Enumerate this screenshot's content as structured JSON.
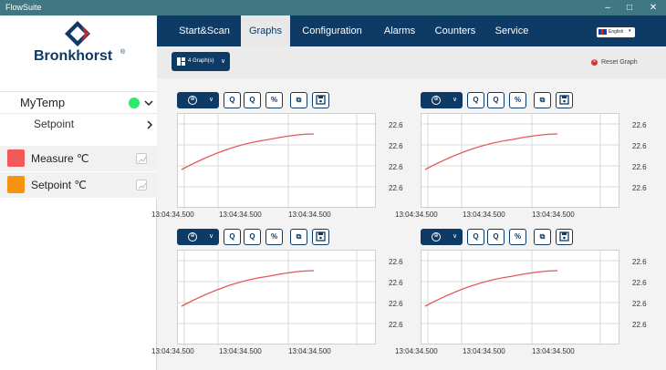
{
  "window": {
    "title": "FlowSuite",
    "controls": [
      "–",
      "□",
      "✕"
    ]
  },
  "brand": {
    "name": "Bronkhorst",
    "registered": "®"
  },
  "device": {
    "name": "MyTemp",
    "status_color": "#2ee86a",
    "parameter": "Setpoint"
  },
  "signals": [
    {
      "label": "Measure",
      "unit": "℃",
      "color": "#f25a5a"
    },
    {
      "label": "Setpoint",
      "unit": "℃",
      "color": "#f7940f"
    }
  ],
  "nav": {
    "tabs": [
      "Start&Scan",
      "Graphs",
      "Configuration",
      "Alarms",
      "Counters",
      "Service"
    ],
    "active": "Graphs",
    "language": "English"
  },
  "toolbar": {
    "graphs_button": "4 Graph(s)",
    "reset": "Reset Graph"
  },
  "graph_tools": {
    "zoom": "⊕",
    "zoom_caret": "∨",
    "zoom_in": "Q",
    "zoom_fit": "Q",
    "percent": "%",
    "crop": "⧉",
    "save": "💾"
  },
  "charts": [
    {
      "y_ticks": [
        "22.6",
        "22.6",
        "22.6",
        "22.6"
      ],
      "x_ticks": [
        "13:04:34.500",
        "13:04:34.500",
        "13:04:34.500"
      ]
    },
    {
      "y_ticks": [
        "22.6",
        "22.6",
        "22.6",
        "22.6"
      ],
      "x_ticks": [
        "13:04:34.500",
        "13:04:34.500",
        "13:04:34.500"
      ]
    },
    {
      "y_ticks": [
        "22.6",
        "22.6",
        "22.6",
        "22.6"
      ],
      "x_ticks": [
        "13:04:34.500",
        "13:04:34.500",
        "13:04:34.500"
      ]
    },
    {
      "y_ticks": [
        "22.6",
        "22.6",
        "22.6",
        "22.6"
      ],
      "x_ticks": [
        "13:04:34.500",
        "13:04:34.500",
        "13:04:34.500"
      ]
    }
  ],
  "colors": {
    "nav": "#0e3a66",
    "line": "#e05a5a"
  }
}
